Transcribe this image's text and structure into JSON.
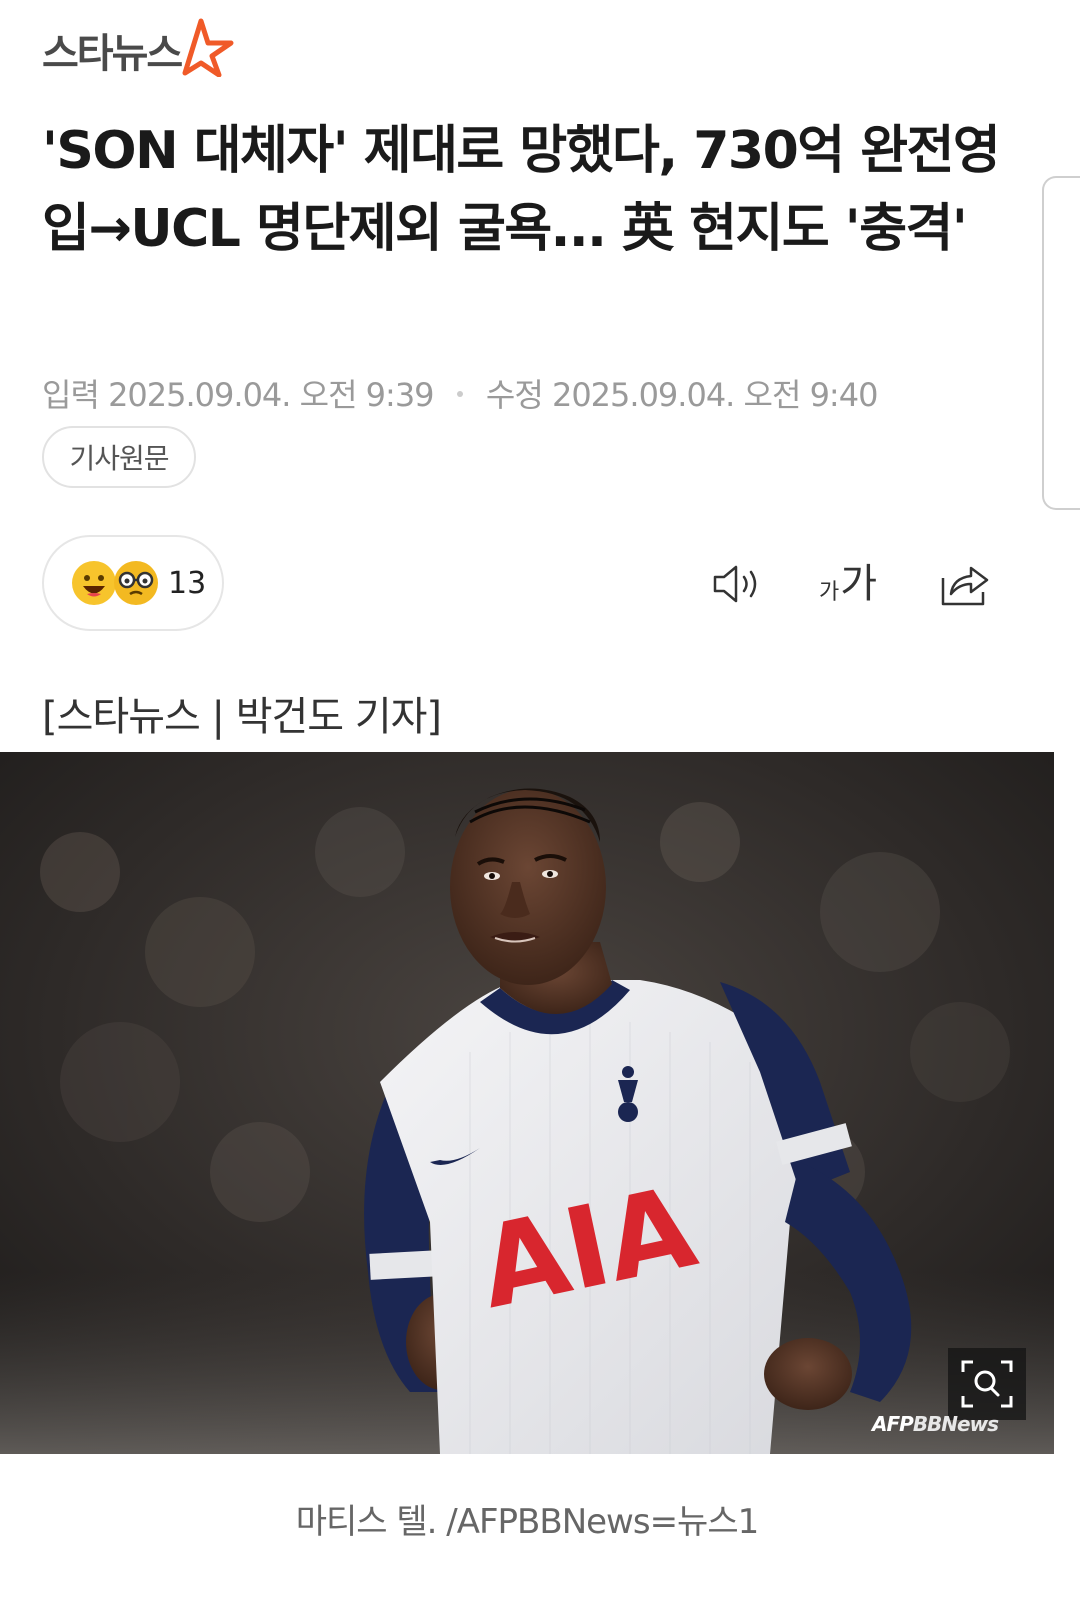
{
  "header": {
    "logo_text": "스타뉴스",
    "logo_accent_color": "#f05a28"
  },
  "article": {
    "headline": "'SON 대체자' 제대로 망했다, 730억 완전영입→UCL 명단제외 굴욕... 英 현지도 '충격'",
    "published_label": "입력",
    "published": "2025.09.04. 오전 9:39",
    "modified_label": "수정",
    "modified": "2025.09.04. 오전 9:40",
    "original_button": "기사원문",
    "reaction_count": "13",
    "byline": "[스타뉴스 | 박건도 기자]",
    "photo": {
      "jersey_sponsor": "AIA",
      "credit_prefix": "AFP",
      "credit_suffix": "BBNews",
      "caption": "마티스 텔. /AFPBBNews=뉴스1"
    }
  },
  "toolbar": {
    "audio_icon": "speaker-icon",
    "font_icon_small": "가",
    "font_icon_big": "가",
    "share_icon": "share-icon"
  },
  "colors": {
    "headline": "#1a1a1a",
    "meta": "#9a9a9a",
    "sponsor_red": "#d8262e",
    "kit_navy": "#1b2652"
  }
}
